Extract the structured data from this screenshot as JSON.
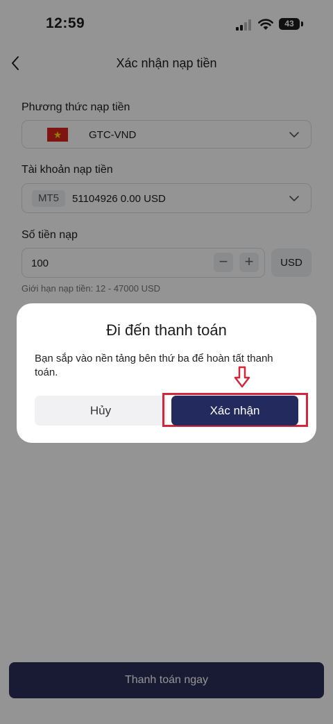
{
  "status_bar": {
    "time": "12:59",
    "battery": "43"
  },
  "header": {
    "title": "Xác nhận nạp tiền"
  },
  "deposit_method": {
    "label": "Phương thức nạp tiền",
    "value": "GTC-VND"
  },
  "deposit_account": {
    "label": "Tài khoản nạp tiền",
    "platform": "MT5",
    "value": "51104926 0.00 USD"
  },
  "amount": {
    "label": "Số tiền nạp",
    "value": "100",
    "minus": "−",
    "plus": "+",
    "currency": "USD",
    "limit_text": "Giới hạn nạp tiền: 12 - 47000 USD"
  },
  "pay_button": "Thanh toán ngay",
  "dialog": {
    "title": "Đi đến thanh toán",
    "message": "Bạn sắp vào nền tảng bên thứ ba để hoàn tất thanh toán.",
    "cancel": "Hủy",
    "confirm": "Xác nhận"
  },
  "colors": {
    "primary": "#232b5e",
    "highlight": "#d3263a",
    "flag_red": "#da251d",
    "flag_star": "#ffdd00"
  },
  "icons": [
    "back-icon",
    "chevron-down-icon",
    "vietnam-flag-icon",
    "down-arrow-icon",
    "signal-icon",
    "wifi-icon",
    "battery-icon"
  ]
}
